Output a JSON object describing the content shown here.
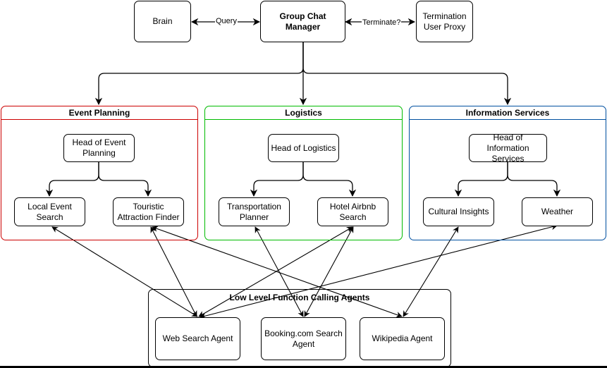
{
  "colors": {
    "event_planning": "#cc0000",
    "logistics": "#00bb00",
    "information_services": "#0050a0",
    "low_level": "#000000"
  },
  "top": {
    "brain": "Brain",
    "manager": "Group Chat Manager",
    "termination": "Termination User Proxy",
    "query_label": "Query",
    "terminate_label": "Terminate?"
  },
  "groups": {
    "event_planning": {
      "title": "Event Planning",
      "head": "Head of Event Planning",
      "children": [
        "Local Event Search",
        "Touristic Attraction Finder"
      ]
    },
    "logistics": {
      "title": "Logistics",
      "head": "Head of Logistics",
      "children": [
        "Transportation Planner",
        "Hotel Airbnb Search"
      ]
    },
    "information_services": {
      "title": "Information Services",
      "head": "Head of Information Services",
      "children": [
        "Cultural Insights",
        "Weather"
      ]
    },
    "low_level": {
      "title": "Low Level Function Calling Agents",
      "agents": [
        "Web Search Agent",
        "Booking.com Search Agent",
        "Wikipedia Agent"
      ]
    }
  },
  "connections": [
    {
      "from": "Local Event Search",
      "to": "Web Search Agent"
    },
    {
      "from": "Touristic Attraction Finder",
      "to": "Web Search Agent"
    },
    {
      "from": "Touristic Attraction Finder",
      "to": "Wikipedia Agent"
    },
    {
      "from": "Transportation Planner",
      "to": "Booking.com Search Agent"
    },
    {
      "from": "Hotel Airbnb Search",
      "to": "Web Search Agent"
    },
    {
      "from": "Hotel Airbnb Search",
      "to": "Booking.com Search Agent"
    },
    {
      "from": "Cultural Insights",
      "to": "Wikipedia Agent"
    },
    {
      "from": "Weather",
      "to": "Web Search Agent"
    }
  ]
}
